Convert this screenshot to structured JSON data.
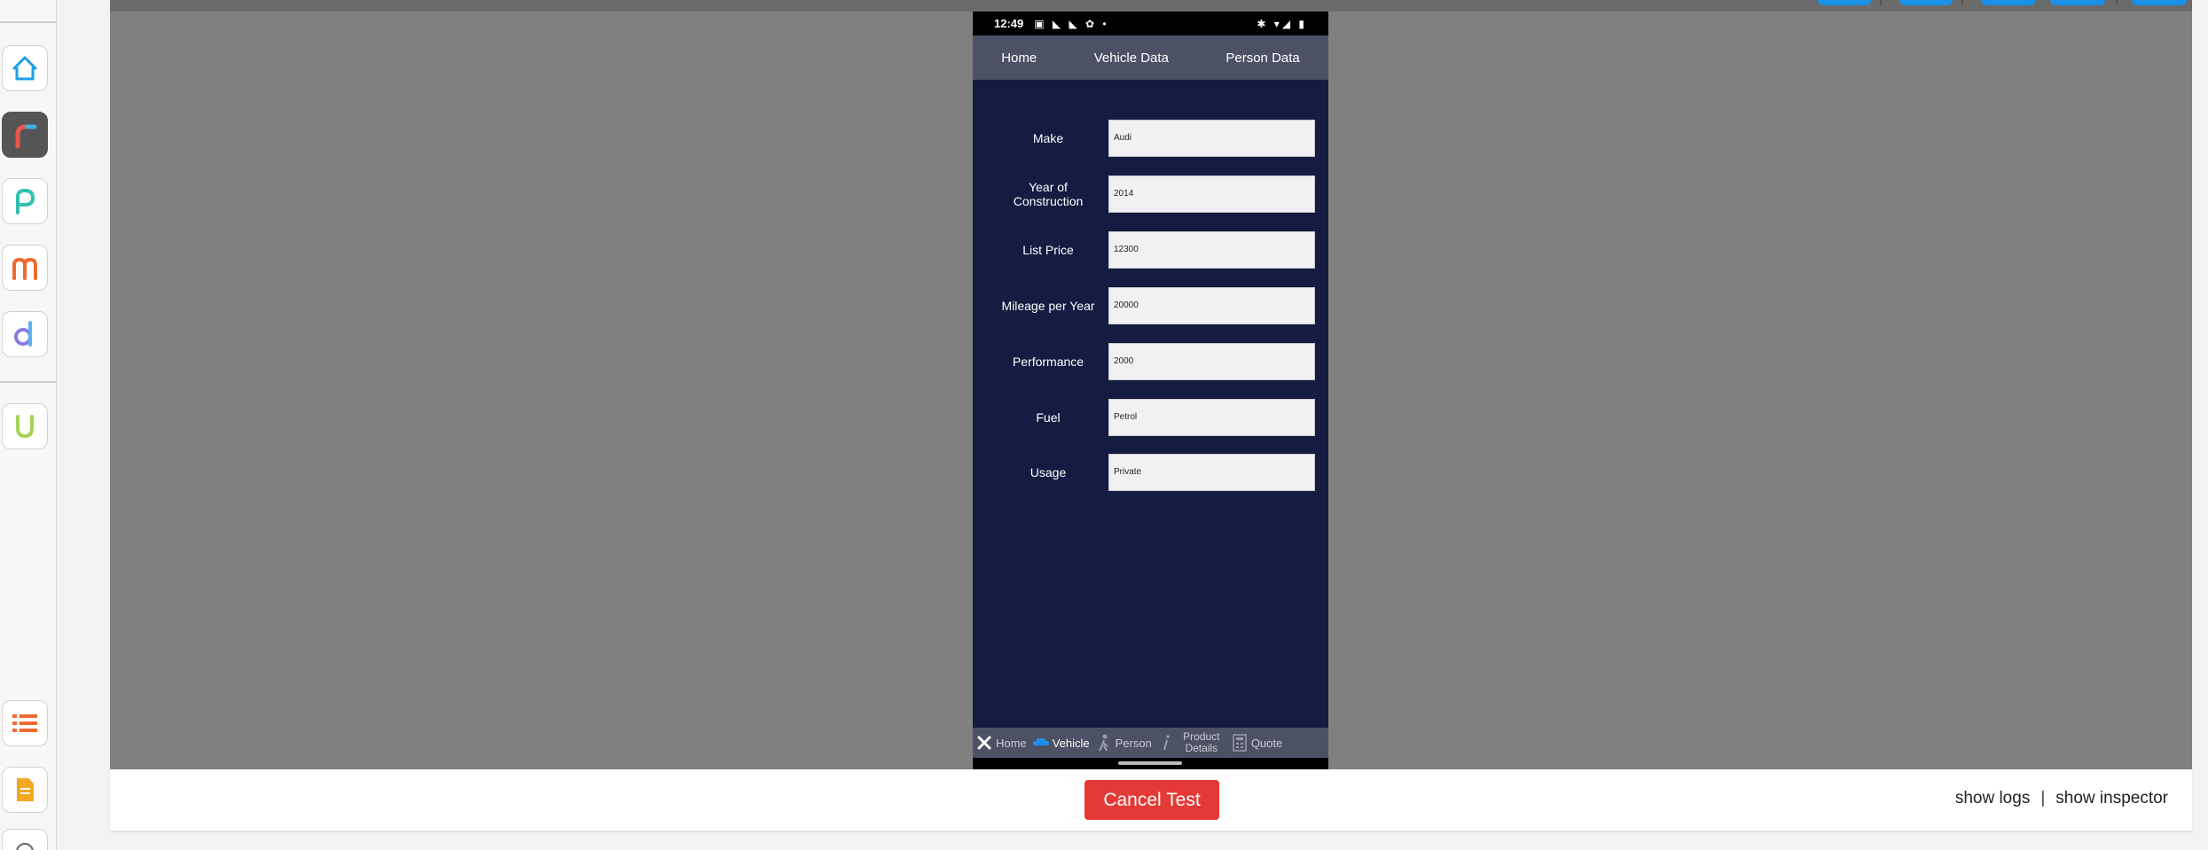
{
  "left_rail": {
    "apps": [
      {
        "icon": "home-icon"
      },
      {
        "icon": "ratchet-app-icon"
      },
      {
        "icon": "p-app-icon"
      },
      {
        "icon": "m-app-icon"
      },
      {
        "icon": "d-app-icon"
      },
      {
        "icon": "u-app-icon"
      }
    ],
    "bottom": [
      {
        "icon": "list-icon"
      },
      {
        "icon": "document-icon"
      }
    ]
  },
  "phone": {
    "status_bar": {
      "time": "12:49",
      "left_icons": "▣ ◣ ◣ ✿ •",
      "right_icons": "✱ ▾◢ ▮"
    },
    "header_tabs": [
      "Home",
      "Vehicle Data",
      "Person Data"
    ],
    "form": {
      "fields": [
        {
          "label": "Make",
          "value": "Audi"
        },
        {
          "label": "Year of Construction",
          "value": "2014"
        },
        {
          "label": "List Price",
          "value": "12300"
        },
        {
          "label": "Mileage per Year",
          "value": "20000"
        },
        {
          "label": "Performance",
          "value": "2000"
        },
        {
          "label": "Fuel",
          "value": "Petrol"
        },
        {
          "label": "Usage",
          "value": "Private"
        }
      ]
    },
    "bottom_tabs": [
      {
        "label": "Home",
        "icon": "tools-icon",
        "active": false
      },
      {
        "label": "Vehicle",
        "icon": "car-icon",
        "active": true
      },
      {
        "label": "Person",
        "icon": "person-icon",
        "active": false
      },
      {
        "label": "Product Details",
        "icon": "info-icon",
        "active": false
      },
      {
        "label": "Quote",
        "icon": "calculator-icon",
        "active": false
      }
    ]
  },
  "bottom_bar": {
    "cancel_label": "Cancel Test",
    "show_logs": "show logs",
    "separator": "|",
    "show_inspector": "show inspector"
  },
  "colors": {
    "stage_bg": "#808080",
    "phone_bg": "#141c42",
    "phone_header": "#4c5165",
    "accent_blue": "#1a90e6",
    "cancel_red": "#e53935"
  }
}
